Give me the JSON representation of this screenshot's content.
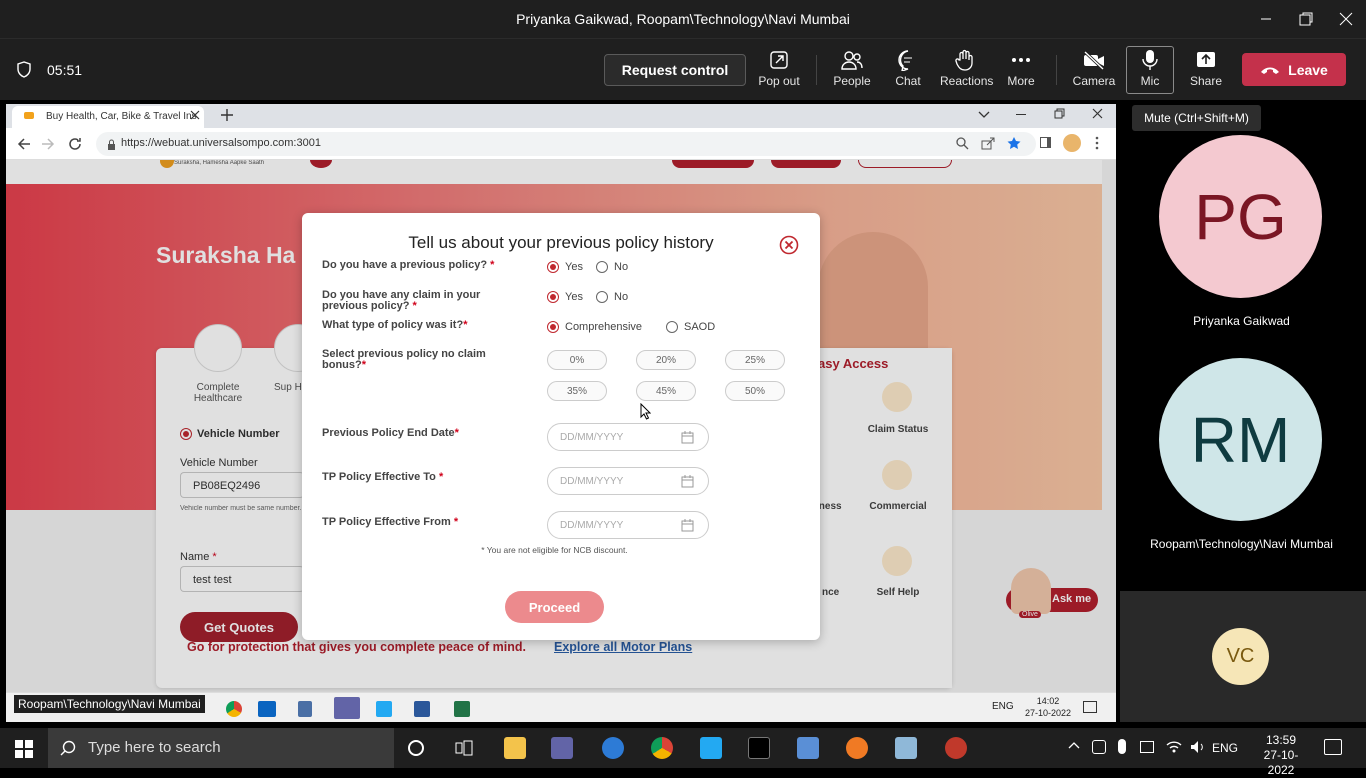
{
  "teams": {
    "window_title": "Priyanka Gaikwad, Roopam\\Technology\\Navi Mumbai",
    "timer": "05:51",
    "request_control": "Request control",
    "buttons": {
      "popout": "Pop out",
      "people": "People",
      "chat": "Chat",
      "reactions": "Reactions",
      "more": "More",
      "camera": "Camera",
      "mic": "Mic",
      "share": "Share",
      "leave": "Leave"
    },
    "mic_tooltip": "Mute (Ctrl+Shift+M)",
    "participants": [
      {
        "initials": "PG",
        "name": "Priyanka Gaikwad",
        "bg": "#f4c9d0",
        "fg": "#7a1624"
      },
      {
        "initials": "RM",
        "name": "Roopam\\Technology\\Navi Mumbai",
        "bg": "#cfe6e8",
        "fg": "#0f3b40"
      }
    ],
    "self_initials": "VC",
    "sharer_label": "Roopam\\Technology\\Navi Mumbai"
  },
  "browser": {
    "tab_title": "Buy Health, Car, Bike & Travel Ins",
    "url": "https://webuat.universalsompo.com:3001"
  },
  "site": {
    "tagline": "Suraksha, Hamesha Aapke Saath",
    "hero_heading": "Suraksha Ha",
    "features": [
      "Complete Healthcare",
      "Sup Health"
    ],
    "vehicle_radio": "Vehicle Number",
    "vehicle_label": "Vehicle Number",
    "vehicle_value": "PB08EQ2496",
    "vehicle_hint": "Vehicle number must be same number.",
    "name_label": "Name",
    "name_value": "test test",
    "get_quotes": "Get Quotes",
    "easy_access": "asy Access",
    "access_items": [
      "Claim Status",
      "iness",
      "Commercial",
      "nce",
      "Self Help"
    ],
    "ask_me": "Ask me",
    "olive": "Olive",
    "footer_text": "Go for protection that gives you complete peace of mind.",
    "footer_link": "Explore all Motor Plans"
  },
  "modal": {
    "title": "Tell us about your previous policy history",
    "q1": "Do you have a previous policy?",
    "q2": "Do you have any claim in your previous policy?",
    "q3": "What type of policy was it?",
    "q4": "Select previous policy no claim bonus?",
    "yes": "Yes",
    "no": "No",
    "comprehensive": "Comprehensive",
    "saod": "SAOD",
    "ncb_options": [
      "0%",
      "20%",
      "25%",
      "35%",
      "45%",
      "50%"
    ],
    "end_date_label": "Previous Policy End Date",
    "tp_to_label": "TP Policy Effective To",
    "tp_from_label": "TP Policy Effective From",
    "date_placeholder": "DD/MM/YYYY",
    "note": "* You are not eligible for NCB discount.",
    "proceed": "Proceed"
  },
  "inner_taskbar": {
    "lang": "ENG",
    "time": "14:02",
    "date": "27-10-2022"
  },
  "taskbar": {
    "search_placeholder": "Type here to search",
    "lang": "ENG",
    "time": "13:59",
    "date": "27-10-2022"
  }
}
